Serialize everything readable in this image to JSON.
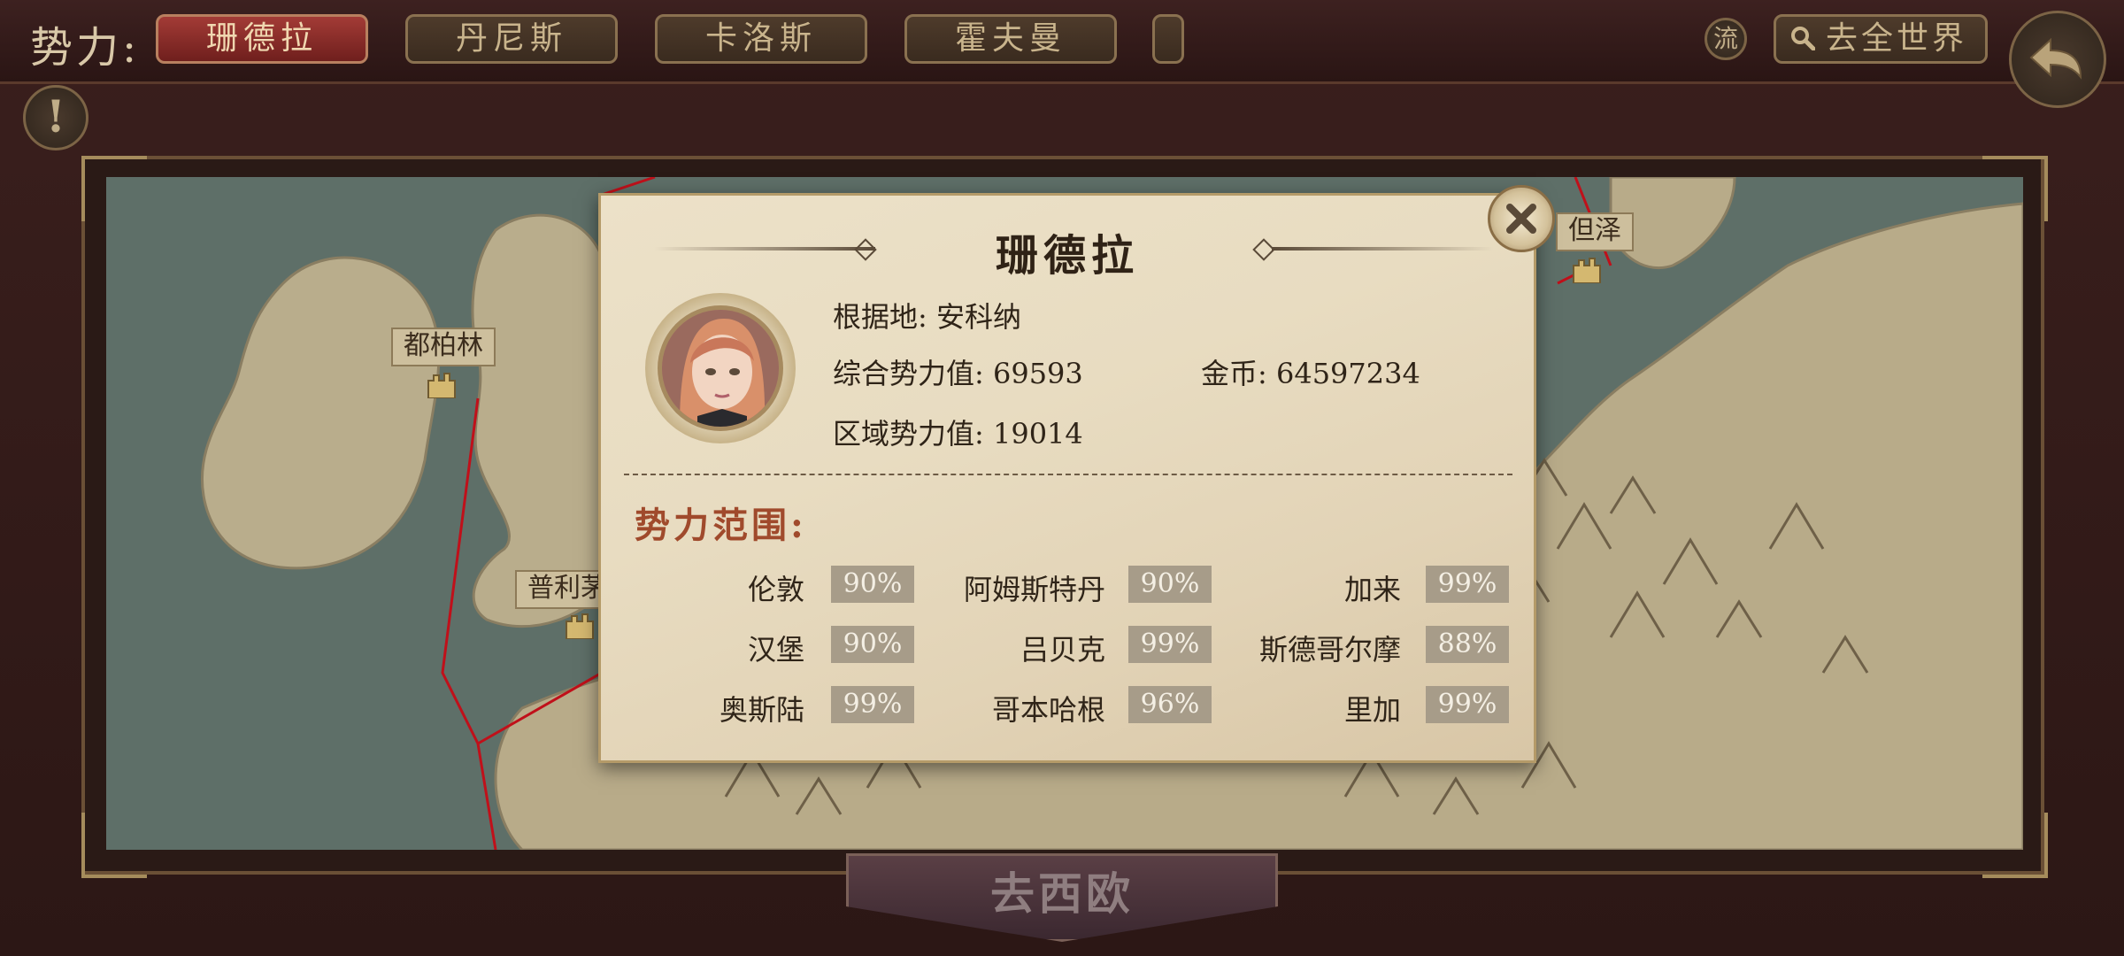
{
  "topbar": {
    "faction_label": "势力:",
    "tabs": [
      "珊德拉",
      "丹尼斯",
      "卡洛斯",
      "霍夫曼"
    ],
    "flow_label": "流",
    "search_label": "去全世界"
  },
  "map": {
    "cities": [
      "都柏林",
      "普利茅",
      "但泽"
    ]
  },
  "go_button": "去西欧",
  "dialog": {
    "title": "珊德拉",
    "base_label": "根据地:",
    "base_value": "安科纳",
    "power_label": "综合势力值:",
    "power_value": "69593",
    "gold_label": "金币:",
    "gold_value": "64597234",
    "region_label": "区域势力值:",
    "region_value": "19014",
    "section_title": "势力范围:",
    "territories": [
      {
        "name": "伦敦",
        "pct": "90%"
      },
      {
        "name": "阿姆斯特丹",
        "pct": "90%"
      },
      {
        "name": "加来",
        "pct": "99%"
      },
      {
        "name": "汉堡",
        "pct": "90%"
      },
      {
        "name": "吕贝克",
        "pct": "99%"
      },
      {
        "name": "斯德哥尔摩",
        "pct": "88%"
      },
      {
        "name": "奥斯陆",
        "pct": "99%"
      },
      {
        "name": "哥本哈根",
        "pct": "96%"
      },
      {
        "name": "里加",
        "pct": "99%"
      }
    ]
  },
  "colors": {
    "active_tab": "#a33b36",
    "section_title": "#a04a2c",
    "route_line": "#c0101a"
  }
}
